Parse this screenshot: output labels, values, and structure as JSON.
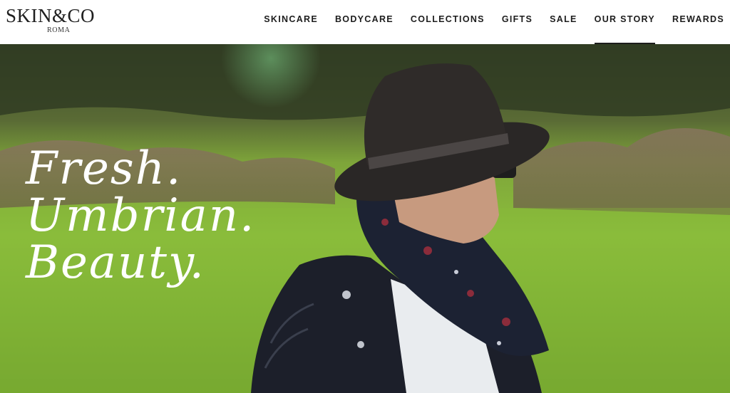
{
  "brand": {
    "name": "SKIN&CO",
    "sub": "ROMA"
  },
  "nav": {
    "items": [
      {
        "label": "SKINCARE",
        "active": false
      },
      {
        "label": "BODYCARE",
        "active": false
      },
      {
        "label": "COLLECTIONS",
        "active": false
      },
      {
        "label": "GIFTS",
        "active": false
      },
      {
        "label": "SALE",
        "active": false
      },
      {
        "label": "OUR STORY",
        "active": true
      },
      {
        "label": "REWARDS",
        "active": false
      }
    ]
  },
  "hero": {
    "lines": [
      "Fresh.",
      "Umbrian.",
      "Beauty."
    ],
    "image": "man-in-hat-in-field"
  },
  "colors": {
    "text_dark": "#1d1d1d",
    "field_green": "#7fb033",
    "tagline": "#ffffff"
  }
}
